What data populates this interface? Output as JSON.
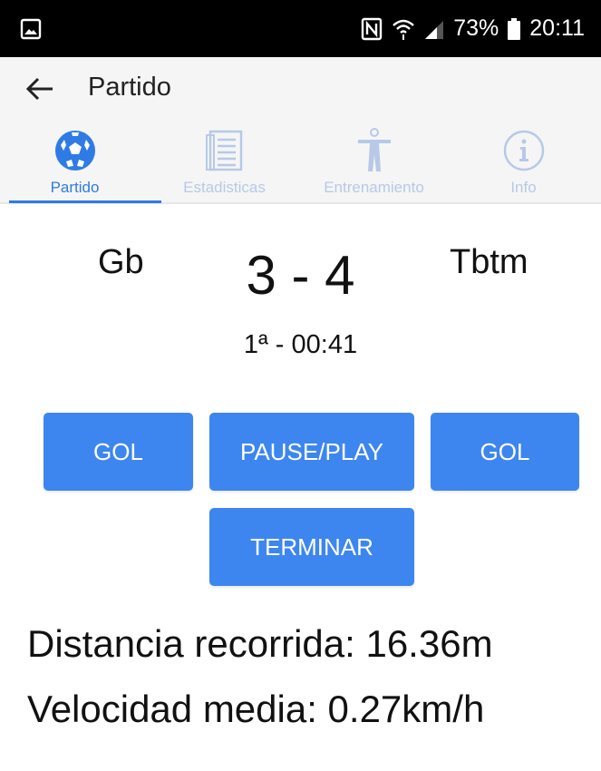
{
  "status_bar": {
    "battery": "73%",
    "time": "20:11",
    "icons": [
      "image-icon",
      "nfc-icon",
      "wifi-icon",
      "signal-icon",
      "battery-icon"
    ]
  },
  "app_bar": {
    "title": "Partido",
    "back_icon": "arrow-left-icon"
  },
  "tabs": [
    {
      "label": "Partido",
      "icon": "soccer-ball-icon",
      "active": true
    },
    {
      "label": "Estadisticas",
      "icon": "document-list-icon",
      "active": false
    },
    {
      "label": "Entrenamiento",
      "icon": "person-icon",
      "active": false
    },
    {
      "label": "Info",
      "icon": "info-icon",
      "active": false
    }
  ],
  "match": {
    "home_team": "Gb",
    "away_team": "Tbtm",
    "score": "3 - 4",
    "clock": "1ª - 00:41"
  },
  "buttons": {
    "gol_home": "GOL",
    "pause_play": "PAUSE/PLAY",
    "gol_away": "GOL",
    "terminar": "TERMINAR"
  },
  "stats": {
    "distance": "Distancia recorrida: 16.36m",
    "speed": "Velocidad media: 0.27km/h"
  },
  "colors": {
    "accent": "#2f7be6",
    "button": "#3d86ef",
    "inactive_tab": "#b7c9e6",
    "app_bar_bg": "#f5f5f5"
  }
}
